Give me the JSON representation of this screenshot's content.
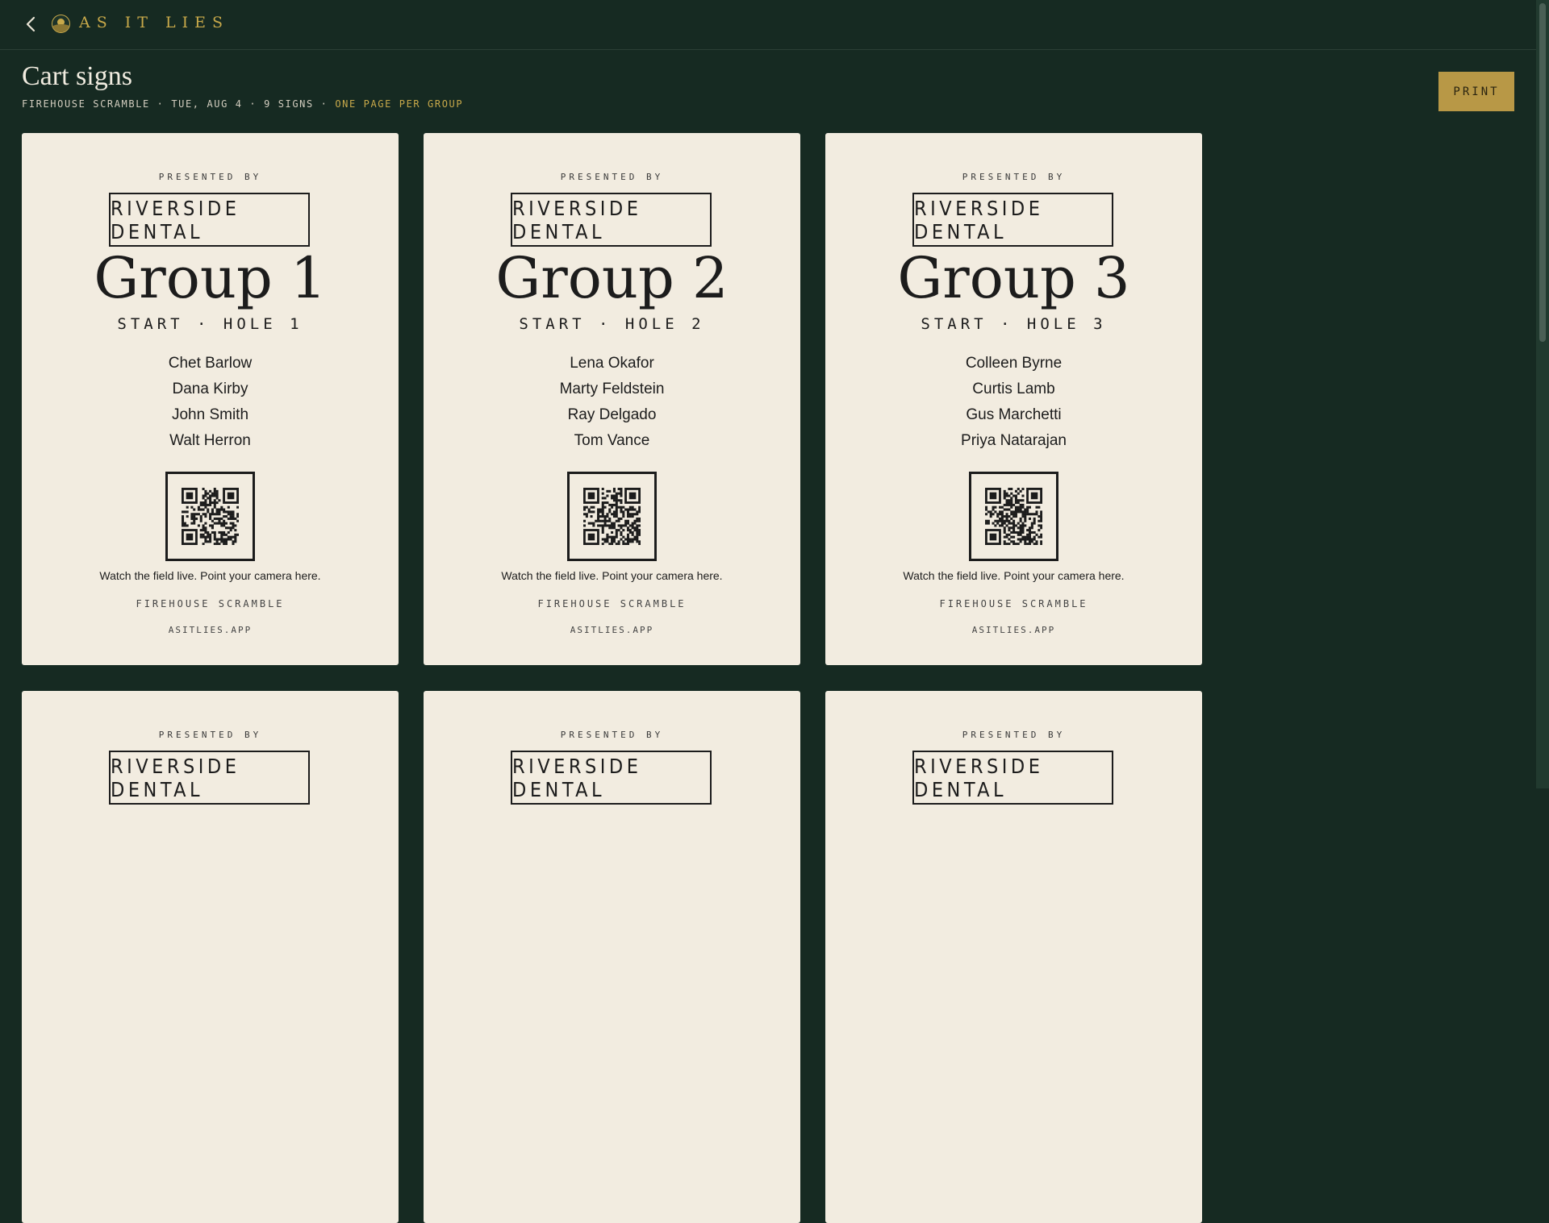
{
  "app": {
    "brand": "AS IT LIES",
    "back_icon": "chevron-left-icon",
    "logo_icon": "sun-emblem-icon"
  },
  "header": {
    "title": "Cart signs",
    "event_name": "FIREHOUSE SCRAMBLE",
    "date": "TUE, AUG 4",
    "sign_count": "9 SIGNS",
    "separator": "·",
    "layout_note": "ONE PAGE PER GROUP",
    "print_label": "PRINT"
  },
  "colors": {
    "background": "#162a22",
    "card": "#f2ece0",
    "accent": "#c8a94a",
    "button": "#b89846"
  },
  "cards": [
    {
      "presented_by": "PRESENTED BY",
      "sponsor": "RIVERSIDE DENTAL",
      "group": "Group 1",
      "start": "START · HOLE 1",
      "players": [
        "Chet Barlow",
        "Dana Kirby",
        "John Smith",
        "Walt Herron"
      ],
      "qr_icon": "qr-code-icon",
      "caption": "Watch the field live. Point your camera here.",
      "event": "FIREHOUSE SCRAMBLE",
      "site": "ASITLIES.APP"
    },
    {
      "presented_by": "PRESENTED BY",
      "sponsor": "RIVERSIDE DENTAL",
      "group": "Group 2",
      "start": "START · HOLE 2",
      "players": [
        "Lena Okafor",
        "Marty Feldstein",
        "Ray Delgado",
        "Tom Vance"
      ],
      "qr_icon": "qr-code-icon",
      "caption": "Watch the field live. Point your camera here.",
      "event": "FIREHOUSE SCRAMBLE",
      "site": "ASITLIES.APP"
    },
    {
      "presented_by": "PRESENTED BY",
      "sponsor": "RIVERSIDE DENTAL",
      "group": "Group 3",
      "start": "START · HOLE 3",
      "players": [
        "Colleen Byrne",
        "Curtis Lamb",
        "Gus Marchetti",
        "Priya Natarajan"
      ],
      "qr_icon": "qr-code-icon",
      "caption": "Watch the field live. Point your camera here.",
      "event": "FIREHOUSE SCRAMBLE",
      "site": "ASITLIES.APP"
    },
    {
      "presented_by": "PRESENTED BY",
      "sponsor": "RIVERSIDE DENTAL"
    },
    {
      "presented_by": "PRESENTED BY",
      "sponsor": "RIVERSIDE DENTAL"
    },
    {
      "presented_by": "PRESENTED BY",
      "sponsor": "RIVERSIDE DENTAL"
    }
  ]
}
